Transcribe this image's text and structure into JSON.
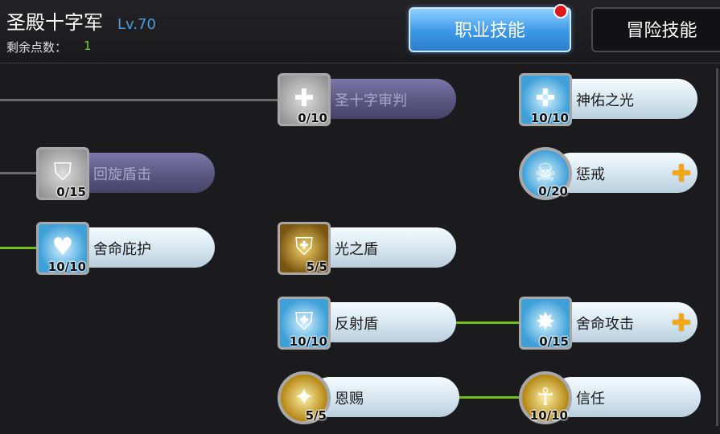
{
  "header": {
    "character_name": "圣殿十字军",
    "level": "Lv.70",
    "points_label": "剩余点数：",
    "points_value": "1"
  },
  "tabs": [
    {
      "label": "职业技能",
      "active": true,
      "has_notification": true
    },
    {
      "label": "冒险技能",
      "active": false
    }
  ],
  "skills": [
    {
      "id": "holy-cross",
      "name": "圣十字审判",
      "level": "0/10",
      "icon": "cross-slash-icon",
      "locked": true,
      "can_upgrade": false
    },
    {
      "id": "divine-light",
      "name": "神佑之光",
      "level": "10/10",
      "icon": "holy-cross-burst-icon",
      "locked": false,
      "can_upgrade": false
    },
    {
      "id": "spin-shield",
      "name": "回旋盾击",
      "level": "0/15",
      "icon": "spinning-shield-icon",
      "locked": true,
      "can_upgrade": false
    },
    {
      "id": "punish",
      "name": "惩戒",
      "level": "0/20",
      "icon": "skull-icon",
      "locked": false,
      "can_upgrade": true
    },
    {
      "id": "sacrifice-guard",
      "name": "舍命庇护",
      "level": "10/10",
      "icon": "heart-shield-icon",
      "locked": false,
      "can_upgrade": false
    },
    {
      "id": "light-shield",
      "name": "光之盾",
      "level": "5/5",
      "icon": "light-shield-icon",
      "locked": false,
      "can_upgrade": false
    },
    {
      "id": "reflect-shield",
      "name": "反射盾",
      "level": "10/10",
      "icon": "reflect-shield-icon",
      "locked": false,
      "can_upgrade": false
    },
    {
      "id": "sacrifice-attack",
      "name": "舍命攻击",
      "level": "0/15",
      "icon": "shield-strike-icon",
      "locked": false,
      "can_upgrade": true
    },
    {
      "id": "grace",
      "name": "恩赐",
      "level": "5/5",
      "icon": "blessing-figure-icon",
      "locked": false,
      "can_upgrade": false
    },
    {
      "id": "trust",
      "name": "信任",
      "level": "10/10",
      "icon": "praying-figure-icon",
      "locked": false,
      "can_upgrade": false
    }
  ],
  "colors": {
    "tab_active": "#3b97e6",
    "notification_dot": "#e01818",
    "connector_active": "#6fbe1c",
    "connector_inactive": "#6a6a6a",
    "plus_button": "#f2a81a",
    "points_value": "#6ad04a",
    "level_text": "#4a9be0"
  }
}
